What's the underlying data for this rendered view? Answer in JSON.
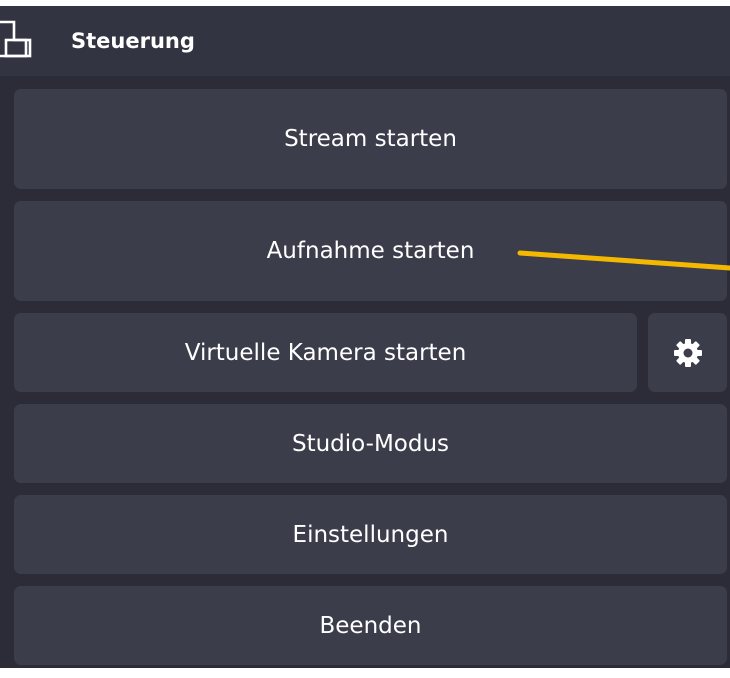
{
  "header": {
    "title": "Steuerung",
    "icon": "dock-window-icon"
  },
  "controls": {
    "stream_label": "Stream starten",
    "recording_label": "Aufnahme starten",
    "virtual_camera_label": "Virtuelle Kamera starten",
    "virtual_camera_settings_icon": "gear-icon",
    "studio_mode_label": "Studio-Modus",
    "settings_label": "Einstellungen",
    "exit_label": "Beenden"
  },
  "colors": {
    "panel_bg": "#2b2c37",
    "header_bg": "#333441",
    "button_bg": "#3c3d4b",
    "text": "#ffffff",
    "annotation_arrow": "#f5b800"
  }
}
